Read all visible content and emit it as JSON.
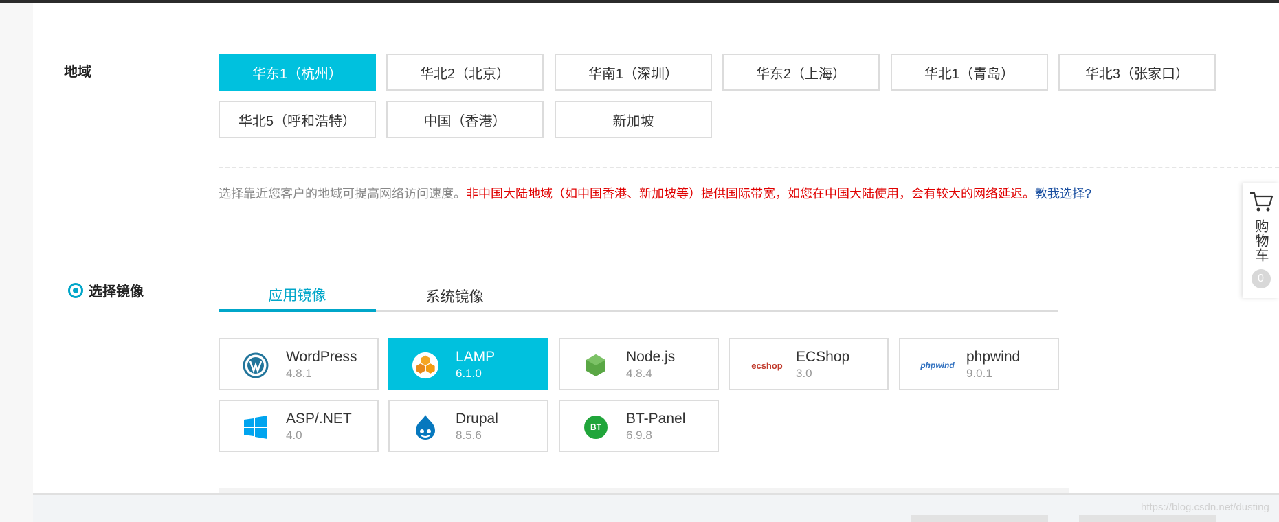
{
  "region": {
    "label": "地域",
    "options": [
      {
        "label": "华东1（杭州）",
        "selected": true
      },
      {
        "label": "华北2（北京）",
        "selected": false
      },
      {
        "label": "华南1（深圳）",
        "selected": false
      },
      {
        "label": "华东2（上海）",
        "selected": false
      },
      {
        "label": "华北1（青岛）",
        "selected": false
      },
      {
        "label": "华北3（张家口）",
        "selected": false
      },
      {
        "label": "华北5（呼和浩特）",
        "selected": false
      },
      {
        "label": "中国（香港）",
        "selected": false
      },
      {
        "label": "新加坡",
        "selected": false
      }
    ],
    "note_gray": "选择靠近您客户的地域可提高网络访问速度。",
    "note_red": "非中国大陆地域（如中国香港、新加坡等）提供国际带宽，如您在中国大陆使用，会有较大的网络延迟。",
    "note_link": "教我选择?"
  },
  "image": {
    "label": "选择镜像",
    "tabs": [
      {
        "label": "应用镜像",
        "active": true
      },
      {
        "label": "系统镜像",
        "active": false
      }
    ],
    "options": [
      {
        "name": "WordPress",
        "version": "4.8.1",
        "icon": "wordpress-icon",
        "selected": false
      },
      {
        "name": "LAMP",
        "version": "6.1.0",
        "icon": "lamp-icon",
        "selected": true
      },
      {
        "name": "Node.js",
        "version": "4.8.4",
        "icon": "nodejs-icon",
        "selected": false
      },
      {
        "name": "ECShop",
        "version": "3.0",
        "icon": "ecshop-icon",
        "selected": false
      },
      {
        "name": "phpwind",
        "version": "9.0.1",
        "icon": "phpwind-icon",
        "selected": false
      },
      {
        "name": "ASP/.NET",
        "version": "4.0",
        "icon": "windows-icon",
        "selected": false
      },
      {
        "name": "Drupal",
        "version": "8.5.6",
        "icon": "drupal-icon",
        "selected": false
      },
      {
        "name": "BT-Panel",
        "version": "6.9.8",
        "icon": "btpanel-icon",
        "selected": false
      }
    ]
  },
  "icon_text": {
    "ecshop": "ecshop",
    "phpwind": "phpwind",
    "bt": "BT"
  },
  "cart": {
    "label": "购物车",
    "count": "0"
  },
  "watermark": "https://blog.csdn.net/dusting",
  "colors": {
    "accent": "#00c1de",
    "tab_active": "#00a6c9",
    "warning": "#e00000",
    "link": "#1a4fa0"
  }
}
